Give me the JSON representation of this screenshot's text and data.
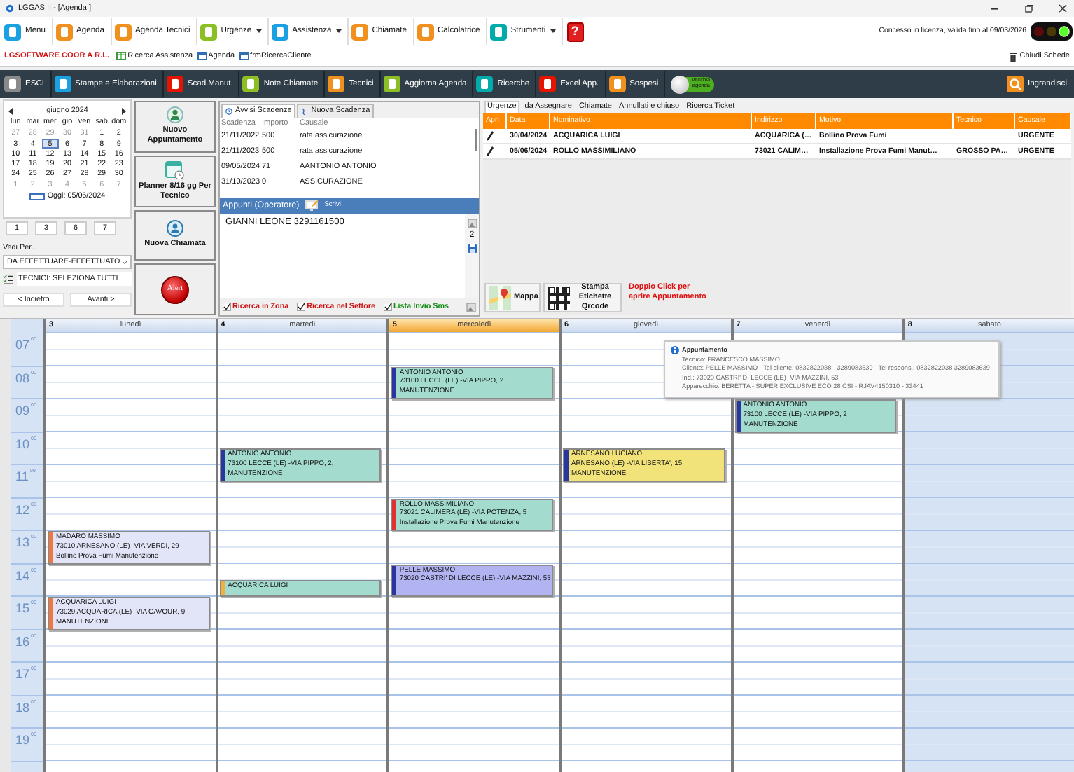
{
  "window": {
    "title": "LGGAS II - [Agenda ]"
  },
  "toolbar": {
    "items": [
      {
        "label": "Menu",
        "color": "#1ba1e2",
        "dropdown": false
      },
      {
        "label": "Agenda",
        "color": "#f0901e",
        "dropdown": false
      },
      {
        "label": "Agenda Tecnici",
        "color": "#f0901e",
        "dropdown": false
      },
      {
        "label": "Urgenze",
        "color": "#8cbf26",
        "dropdown": true
      },
      {
        "label": "Assistenza",
        "color": "#1ba1e2",
        "dropdown": true
      },
      {
        "label": "Chiamate",
        "color": "#f0901e",
        "dropdown": false
      },
      {
        "label": "Calcolatrice",
        "color": "#f0901e",
        "dropdown": false
      },
      {
        "label": "Strumenti",
        "color": "#00aba9",
        "dropdown": true
      }
    ],
    "help": "?",
    "license": "Concesso in licenza, valida fino al 09/03/2026",
    "lights": [
      {
        "color": "#5a0a0a",
        "on": false
      },
      {
        "color": "#4a3a08",
        "on": false
      },
      {
        "color": "#5bff2a",
        "on": true
      }
    ]
  },
  "company_bar": {
    "company": "LGSOFTWARE COOR A R.L.",
    "links": [
      "Ricerca Assistenza",
      "Agenda",
      "frmRicercaCliente"
    ],
    "close_tabs": "Chiudi Schede"
  },
  "action_bar": {
    "items": [
      {
        "label": "ESCI",
        "color": "#8a8a8a"
      },
      {
        "label": "Stampe e Elaborazioni",
        "color": "#1ba1e2"
      },
      {
        "label": "Scad.Manut.",
        "color": "#e51400"
      },
      {
        "label": "Note Chiamate",
        "color": "#8cbf26"
      },
      {
        "label": "Tecnici",
        "color": "#f0901e"
      },
      {
        "label": "Aggiorna Agenda",
        "color": "#8cbf26"
      },
      {
        "label": "Ricerche",
        "color": "#00aba9"
      },
      {
        "label": "Excel App.",
        "color": "#e51400"
      },
      {
        "label": "Sospesi",
        "color": "#f0901e"
      }
    ],
    "toggle": {
      "label": "vecchia agenda",
      "on": true
    },
    "zoom_button": "Ingrandisci"
  },
  "mini_calendar": {
    "month": "giugno 2024",
    "weekdays": [
      "lun",
      "mar",
      "mer",
      "gio",
      "ven",
      "sab",
      "dom"
    ],
    "days": [
      {
        "d": "27",
        "muted": true,
        "selected": false
      },
      {
        "d": "28",
        "muted": true,
        "selected": false
      },
      {
        "d": "29",
        "muted": true,
        "selected": false
      },
      {
        "d": "30",
        "muted": true,
        "selected": false
      },
      {
        "d": "31",
        "muted": true,
        "selected": false
      },
      {
        "d": "1",
        "muted": false,
        "selected": false
      },
      {
        "d": "2",
        "muted": false,
        "selected": false
      },
      {
        "d": "3",
        "muted": false,
        "selected": false
      },
      {
        "d": "4",
        "muted": false,
        "selected": false
      },
      {
        "d": "5",
        "muted": false,
        "selected": true
      },
      {
        "d": "6",
        "muted": false,
        "selected": false
      },
      {
        "d": "7",
        "muted": false,
        "selected": false
      },
      {
        "d": "8",
        "muted": false,
        "selected": false
      },
      {
        "d": "9",
        "muted": false,
        "selected": false
      },
      {
        "d": "10",
        "muted": false,
        "selected": false
      },
      {
        "d": "11",
        "muted": false,
        "selected": false
      },
      {
        "d": "12",
        "muted": false,
        "selected": false
      },
      {
        "d": "13",
        "muted": false,
        "selected": false
      },
      {
        "d": "14",
        "muted": false,
        "selected": false
      },
      {
        "d": "15",
        "muted": false,
        "selected": false
      },
      {
        "d": "16",
        "muted": false,
        "selected": false
      },
      {
        "d": "17",
        "muted": false,
        "selected": false
      },
      {
        "d": "18",
        "muted": false,
        "selected": false
      },
      {
        "d": "19",
        "muted": false,
        "selected": false
      },
      {
        "d": "20",
        "muted": false,
        "selected": false
      },
      {
        "d": "21",
        "muted": false,
        "selected": false
      },
      {
        "d": "22",
        "muted": false,
        "selected": false
      },
      {
        "d": "23",
        "muted": false,
        "selected": false
      },
      {
        "d": "24",
        "muted": false,
        "selected": false
      },
      {
        "d": "25",
        "muted": false,
        "selected": false
      },
      {
        "d": "26",
        "muted": false,
        "selected": false
      },
      {
        "d": "27",
        "muted": false,
        "selected": false
      },
      {
        "d": "28",
        "muted": false,
        "selected": false
      },
      {
        "d": "29",
        "muted": false,
        "selected": false
      },
      {
        "d": "30",
        "muted": false,
        "selected": false
      },
      {
        "d": "1",
        "muted": true,
        "selected": false
      },
      {
        "d": "2",
        "muted": true,
        "selected": false
      },
      {
        "d": "3",
        "muted": true,
        "selected": false
      },
      {
        "d": "4",
        "muted": true,
        "selected": false
      },
      {
        "d": "5",
        "muted": true,
        "selected": false
      },
      {
        "d": "6",
        "muted": true,
        "selected": false
      },
      {
        "d": "7",
        "muted": true,
        "selected": false
      }
    ],
    "today": "Oggi: 05/06/2024"
  },
  "view_buttons": [
    "1",
    "3",
    "6",
    "7"
  ],
  "view_by": {
    "label": "Vedi Per..",
    "value": "DA EFFETTUARE-EFFETTUATO"
  },
  "technicians": "TECNICI: SELEZIONA TUTTI",
  "nav": {
    "back": "< Indietro",
    "forward": "Avanti >"
  },
  "quick_buttons": [
    {
      "label": "Nuovo Appuntamento",
      "kind": "person"
    },
    {
      "label": "Planner 8/16 gg Per Tecnico",
      "kind": "calendar"
    },
    {
      "label": "Nuova Chiamata",
      "kind": "support"
    },
    {
      "label": "Alert",
      "kind": "alert"
    }
  ],
  "deadlines": {
    "tabs": [
      {
        "label": "Avvisi Scadenze",
        "selected": true
      },
      {
        "label": "Nuova Scadenza",
        "selected": false
      }
    ],
    "columns": [
      "Scadenza",
      "Importo",
      "Causale"
    ],
    "rows": [
      [
        "21/11/2022",
        "500",
        "rata assicurazione"
      ],
      [
        "21/11/2023",
        "500",
        "rata assicurazione"
      ],
      [
        "09/05/2024",
        "71",
        "AANTONIO ANTONIO"
      ],
      [
        "31/10/2023",
        "0",
        "ASSICURAZIONE"
      ]
    ]
  },
  "notes": {
    "title": "Appunti  (Operatore)",
    "write": "Scrivi",
    "text": "GIANNI LEONE 3291161500",
    "counter": "2",
    "options": [
      {
        "label": "Ricerca in Zona",
        "checked": true,
        "color": "#d01010"
      },
      {
        "label": "Ricerca nel Settore",
        "checked": true,
        "color": "#d01010"
      },
      {
        "label": "Lista Invio Sms",
        "checked": true,
        "color": "#108a10"
      }
    ]
  },
  "urgent": {
    "tabs": [
      {
        "label": "Urgenze",
        "selected": true
      },
      {
        "label": "da Assegnare",
        "selected": false
      },
      {
        "label": "Chiamate",
        "selected": false
      },
      {
        "label": "Annullati e chiuso",
        "selected": false
      },
      {
        "label": "Ricerca Ticket",
        "selected": false
      }
    ],
    "columns": [
      "Apri",
      "Data",
      "Nominativo",
      "Indirizzo",
      "Motivo",
      "Tecnico",
      "Causale"
    ],
    "rows": [
      [
        "",
        "30/04/2024",
        "ACQUARICA LUIGI",
        "ACQUARICA (…",
        "Bollino Prova Fumi",
        "",
        "URGENTE"
      ],
      [
        "",
        "05/06/2024",
        "ROLLO MASSIMILIANO",
        "73021 CALIM…",
        "Installazione Prova Fumi Manut…",
        "GROSSO PA…",
        "URGENTE"
      ]
    ],
    "map_button": "Mappa",
    "qr_button": "Stampa Etichette Qrcode",
    "hint": "Doppio Click per aprire Appuntamento"
  },
  "agenda": {
    "hours": [
      {
        "h": "07",
        "m": "00"
      },
      {
        "h": "08",
        "m": "00"
      },
      {
        "h": "09",
        "m": "00"
      },
      {
        "h": "10",
        "m": "00"
      },
      {
        "h": "11",
        "m": "00"
      },
      {
        "h": "12",
        "m": "00"
      },
      {
        "h": "13",
        "m": "00"
      },
      {
        "h": "14",
        "m": "00"
      },
      {
        "h": "15",
        "m": "00"
      },
      {
        "h": "16",
        "m": "00"
      },
      {
        "h": "17",
        "m": "00"
      },
      {
        "h": "18",
        "m": "00"
      },
      {
        "h": "19",
        "m": "00"
      }
    ],
    "days": [
      {
        "number": "3",
        "name": "lunedì",
        "today": false,
        "weekend": false,
        "slots": [
          {
            "kind": "free"
          },
          {
            "kind": "free"
          },
          {
            "kind": "free"
          },
          {
            "kind": "free"
          },
          {
            "kind": "free"
          },
          {
            "kind": "free"
          },
          {
            "kind": "free"
          },
          {
            "kind": "free"
          },
          {
            "kind": "free"
          },
          {
            "kind": "free"
          },
          {
            "kind": "free"
          },
          {
            "kind": "free"
          },
          {
            "kind": "lavender",
            "long": true,
            "client": "MADARO MASSIMO",
            "address": "73010 ARNESANO (LE) -VIA VERDI, 29",
            "reason": "Bollino Prova Fumi Manutenzione",
            "color": "#f07840"
          },
          {
            "kind": "free"
          },
          {
            "kind": "free"
          },
          {
            "kind": "lavender",
            "long": true,
            "client": "ACQUARICA LUIGI",
            "address": "73029 ACQUARICA (LE) -VIA CAVOUR, 9",
            "reason": "MANUTENZIONE",
            "color": "#f07840"
          }
        ]
      },
      {
        "number": "4",
        "name": "martedì",
        "today": false,
        "weekend": false,
        "slots": [
          {
            "kind": "free"
          },
          {
            "kind": "free"
          },
          {
            "kind": "free"
          },
          {
            "kind": "free"
          },
          {
            "kind": "free"
          },
          {
            "kind": "free"
          },
          {
            "kind": "free"
          },
          {
            "kind": "teal",
            "long": true,
            "client": "ANTONIO ANTONIO",
            "address": "73100 LECCE (LE) -VIA PIPPO, 2,",
            "reason": "MANUTENZIONE",
            "color": "#2a36a0"
          },
          {
            "kind": "free"
          },
          {
            "kind": "free"
          },
          {
            "kind": "free"
          },
          {
            "kind": "free"
          },
          {
            "kind": "free"
          },
          {
            "kind": "free"
          },
          {
            "kind": "teal",
            "long": false,
            "client": "ACQUARICA LUIGI",
            "color": "#f0b040"
          }
        ]
      },
      {
        "number": "5",
        "name": "mercoledì",
        "today": true,
        "weekend": false,
        "slots": [
          {
            "kind": "free"
          },
          {
            "kind": "free"
          },
          {
            "kind": "teal",
            "long": true,
            "client": "ANTONIO ANTONIO",
            "address": "73100 LECCE (LE) -VIA PIPPO, 2",
            "reason": "MANUTENZIONE",
            "color": "#2a36a0"
          },
          {
            "kind": "free"
          },
          {
            "kind": "free"
          },
          {
            "kind": "free"
          },
          {
            "kind": "free"
          },
          {
            "kind": "free"
          },
          {
            "kind": "free"
          },
          {
            "kind": "teal",
            "long": true,
            "client": "ROLLO MASSIMILIANO",
            "address": "73021 CALIMERA (LE) -VIA POTENZA, 5",
            "reason": "Installazione Prova Fumi Manutenzione",
            "color": "#e03030"
          },
          {
            "kind": "free"
          },
          {
            "kind": "free"
          },
          {
            "kind": "violet",
            "long": true,
            "client": "PELLE MASSIMO",
            "address": "73020 CASTRI' DI LECCE (LE) -VIA MAZZINI, 53",
            "color": "#2a36a0"
          }
        ]
      },
      {
        "number": "6",
        "name": "giovedì",
        "today": false,
        "weekend": false,
        "slots": [
          {
            "kind": "free"
          },
          {
            "kind": "free"
          },
          {
            "kind": "free"
          },
          {
            "kind": "free"
          },
          {
            "kind": "free"
          },
          {
            "kind": "free"
          },
          {
            "kind": "free"
          },
          {
            "kind": "yellow",
            "long": true,
            "client": "ARNESANO LUCIANO",
            "address": "ARNESANO (LE) -VIA LIBERTA', 15",
            "reason": "MANUTENZIONE",
            "color": "#2a36a0"
          }
        ]
      },
      {
        "number": "7",
        "name": "venerdì",
        "today": false,
        "weekend": false,
        "slots": [
          {
            "kind": "free"
          },
          {
            "kind": "free"
          },
          {
            "kind": "free"
          },
          {
            "kind": "free"
          },
          {
            "kind": "teal",
            "long": true,
            "client": "ANTONIO ANTONIO",
            "address": "73100 LECCE (LE) -VIA PIPPO, 2",
            "reason": "MANUTENZIONE",
            "color": "#2a36a0"
          }
        ]
      },
      {
        "number": "8",
        "name": "sabato",
        "today": false,
        "weekend": true
      }
    ],
    "tooltip": {
      "title": "Appuntamento",
      "lines": [
        "Tecnico: FRANCESCO MASSIMO;",
        "Cliente: PELLE MASSIMO - Tel cliente: 0832822038 - 3289083639 - Tel respons.: 0832822038 3289083639",
        "Ind.: 73020 CASTRI' DI LECCE (LE) -VIA MAZZINI, 53",
        "Apparecchio: BERETTA - SUPER EXCLUSIVE ECO 28 CSI - RJAV4150310 - 33441"
      ]
    }
  }
}
